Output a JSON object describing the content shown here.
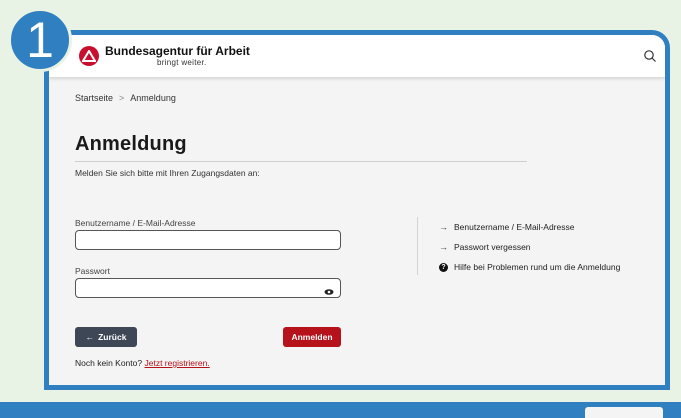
{
  "step": {
    "number": "1"
  },
  "header": {
    "brand_title": "Bundesagentur für Arbeit",
    "brand_tagline": "bringt weiter.",
    "search_icon": "search-icon"
  },
  "breadcrumb": {
    "home": "Startseite",
    "separator": ">",
    "current": "Anmeldung"
  },
  "page": {
    "title": "Anmeldung",
    "intro": "Melden Sie sich bitte mit Ihren Zugangsdaten an:"
  },
  "form": {
    "username_label": "Benutzername / E-Mail-Adresse",
    "username_value": "",
    "password_label": "Passwort",
    "password_value": "",
    "back_label": "Zurück",
    "back_icon": "arrow-left-icon",
    "login_label": "Anmelden"
  },
  "help_links": [
    {
      "icon": "arrow-right-icon",
      "label": "Benutzername / E-Mail-Adresse"
    },
    {
      "icon": "arrow-right-icon",
      "label": "Passwort vergessen"
    },
    {
      "icon": "question-icon",
      "label": "Hilfe bei Problemen rund um die Anmeldung"
    }
  ],
  "register": {
    "prompt": "Noch kein Konto?",
    "link_label": "Jetzt registrieren."
  },
  "colors": {
    "accent_blue": "#2f7fc1",
    "brand_red": "#b5121b",
    "back_button": "#3d4756",
    "background": "#e8f3e6"
  }
}
